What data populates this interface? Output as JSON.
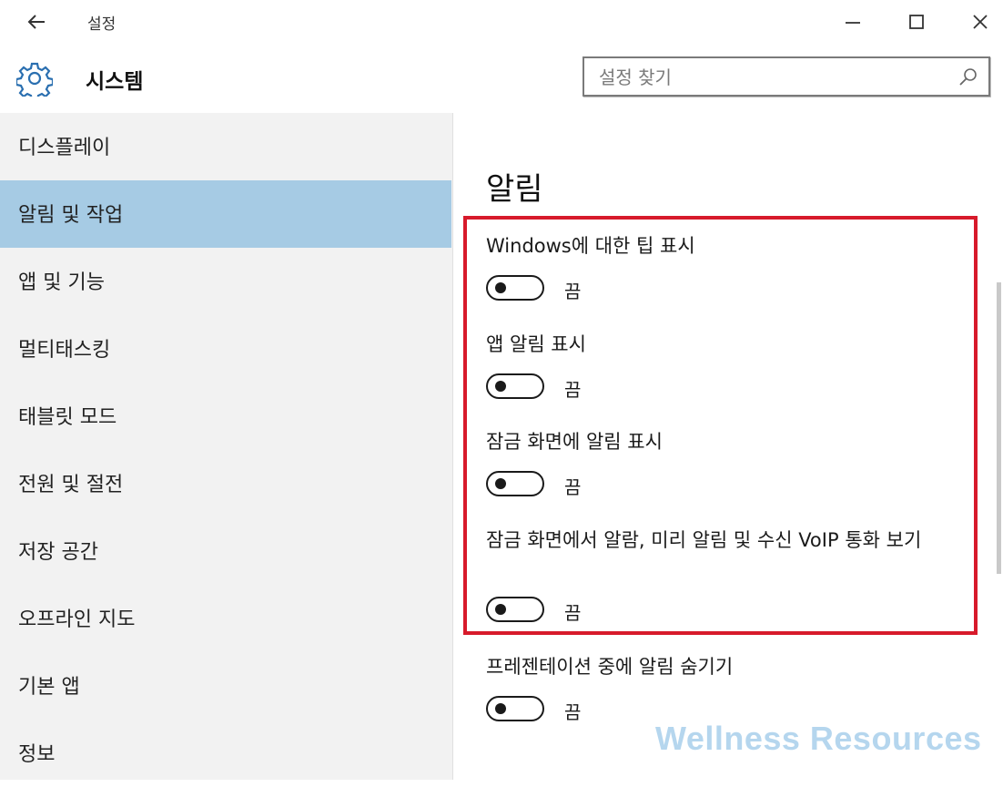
{
  "window": {
    "title": "설정",
    "back_icon": "back-arrow-icon",
    "minimize_icon": "minimize-icon",
    "maximize_icon": "maximize-icon",
    "close_icon": "close-icon"
  },
  "header": {
    "icon": "gear-icon",
    "title": "시스템",
    "search": {
      "placeholder": "설정 찾기",
      "value": "",
      "icon": "search-icon"
    }
  },
  "sidebar": {
    "items": [
      {
        "label": "디스플레이",
        "selected": false
      },
      {
        "label": "알림 및 작업",
        "selected": true
      },
      {
        "label": "앱 및 기능",
        "selected": false
      },
      {
        "label": "멀티태스킹",
        "selected": false
      },
      {
        "label": "태블릿 모드",
        "selected": false
      },
      {
        "label": "전원 및 절전",
        "selected": false
      },
      {
        "label": "저장 공간",
        "selected": false
      },
      {
        "label": "오프라인 지도",
        "selected": false
      },
      {
        "label": "기본 앱",
        "selected": false
      },
      {
        "label": "정보",
        "selected": false
      }
    ]
  },
  "content": {
    "title": "알림",
    "settings": [
      {
        "label": "Windows에 대한 팁 표시",
        "state": "끔",
        "on": false
      },
      {
        "label": "앱 알림 표시",
        "state": "끔",
        "on": false
      },
      {
        "label": "잠금 화면에 알림 표시",
        "state": "끔",
        "on": false
      },
      {
        "label": "잠금 화면에서 알람, 미리 알림 및 수신 VoIP 통화 보기",
        "state": "끔",
        "on": false
      },
      {
        "label": "프레젠테이션 중에 알림 숨기기",
        "state": "끔",
        "on": false
      }
    ]
  },
  "highlight_color": "#d71a2b",
  "accent_color": "#a6cbe4",
  "watermark": "Wellness Resources"
}
